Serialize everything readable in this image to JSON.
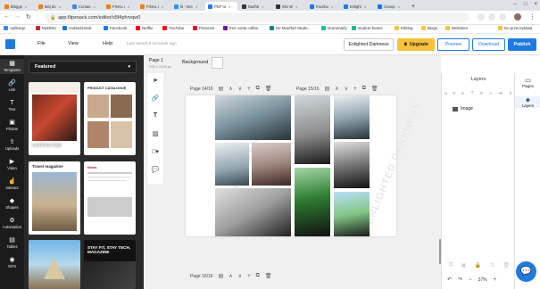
{
  "browser": {
    "tabs": [
      "Blogge",
      "Mój do",
      "Contan",
      "FINAL I",
      "FINAL I",
      "lit - Sec",
      "PDF to",
      "Dashb",
      "Wix W",
      "Facebo",
      "Enlight",
      "Cramp"
    ],
    "url": "app.flipsnack.com/editor/s5f4phrvqw0",
    "bookmarks": [
      "Aplikacje",
      "MyDMU",
      "mobiedzienik",
      "Facebook",
      "Netflix",
      "YouTube",
      "Pinterest",
      "free costa coffee",
      "De Montfort Stude...",
      "Grammarly",
      "student beans",
      "Editing",
      "Blogs",
      "Websites",
      "Do przeczytania"
    ]
  },
  "app": {
    "menu": [
      "File",
      "View",
      "Help"
    ],
    "saved_status": "Last saved 5 seconds ago",
    "doc_name": "Enlighted Darkness",
    "buttons": {
      "upgrade": "Upgrade",
      "preview": "Preview",
      "download": "Download",
      "publish": "Publish"
    }
  },
  "rail": [
    "Templates",
    "Link",
    "Text",
    "Photos",
    "Uploads",
    "Video",
    "Interact",
    "Shapes",
    "Automation",
    "Tables",
    "GIFs"
  ],
  "panel": {
    "dropdown": "Featured",
    "thumbs": [
      "Luxurious rugs",
      "PRODUCT CATALOGUE",
      "Travel magazine",
      "News",
      "",
      "STAY FIT, STAY TECH, MAGAZINE"
    ]
  },
  "canvas": {
    "page_label": "Page 1",
    "page_size": "790 x 1026 px",
    "background_label": "Background",
    "spread_left": "Page 14/16",
    "spread_right": "Page 15/16",
    "next_page": "Page 16/16",
    "watermark": "ENLIGHTED DARKNESS"
  },
  "layers": {
    "title": "Layers",
    "item": "Image",
    "zoom": "37%"
  },
  "right_tabs": [
    "Pages",
    "Layers"
  ],
  "colors": {
    "accent": "#1f7ae0",
    "upgrade": "#f7c13b",
    "rail": "#1b1b1b",
    "panel": "#2a2a2a"
  }
}
